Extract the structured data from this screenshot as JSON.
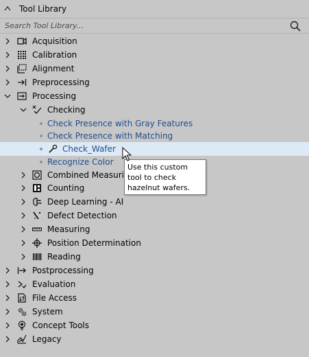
{
  "panel": {
    "title": "Tool Library"
  },
  "search": {
    "placeholder": "Search Tool Library..."
  },
  "tree": [
    {
      "label": "Acquisition",
      "icon": "camera-icon",
      "expanded": false
    },
    {
      "label": "Calibration",
      "icon": "dot-grid-icon",
      "expanded": false
    },
    {
      "label": "Alignment",
      "icon": "alignment-icon",
      "expanded": false
    },
    {
      "label": "Preprocessing",
      "icon": "arrow-bar-icon",
      "expanded": false
    },
    {
      "label": "Processing",
      "icon": "process-arrow-icon",
      "expanded": true
    },
    {
      "label": "Checking",
      "icon": "checking-icon",
      "expanded": true
    },
    {
      "label": "Check Presence with Gray Features"
    },
    {
      "label": "Check Presence with Matching"
    },
    {
      "label": "Check_Wafer",
      "icon": "wrench-icon",
      "selected": true
    },
    {
      "label": "Recognize Color"
    },
    {
      "label": "Combined Measuring",
      "icon": "combined-measure-icon",
      "expanded": false
    },
    {
      "label": "Counting",
      "icon": "counting-icon",
      "expanded": false
    },
    {
      "label": "Deep Learning - AI",
      "icon": "brain-icon",
      "expanded": false
    },
    {
      "label": "Defect Detection",
      "icon": "defect-icon",
      "expanded": false
    },
    {
      "label": "Measuring",
      "icon": "ruler-icon",
      "expanded": false
    },
    {
      "label": "Position Determination",
      "icon": "crosshair-icon",
      "expanded": false
    },
    {
      "label": "Reading",
      "icon": "barcode-icon",
      "expanded": false
    },
    {
      "label": "Postprocessing",
      "icon": "bar-arrow-icon",
      "expanded": false
    },
    {
      "label": "Evaluation",
      "icon": "evaluation-icon",
      "expanded": false
    },
    {
      "label": "File Access",
      "icon": "file-io-icon",
      "expanded": false
    },
    {
      "label": "System",
      "icon": "gears-icon",
      "expanded": false
    },
    {
      "label": "Concept Tools",
      "icon": "lightbulb-icon",
      "expanded": false
    },
    {
      "label": "Legacy",
      "icon": "legacy-icon",
      "expanded": false
    }
  ],
  "tooltip": {
    "text": "Use this custom tool to check hazelnut wafers."
  },
  "colors": {
    "background": "#c7c7c7",
    "selected_row": "#ddeaf6",
    "link_text": "#1f4e8c"
  }
}
